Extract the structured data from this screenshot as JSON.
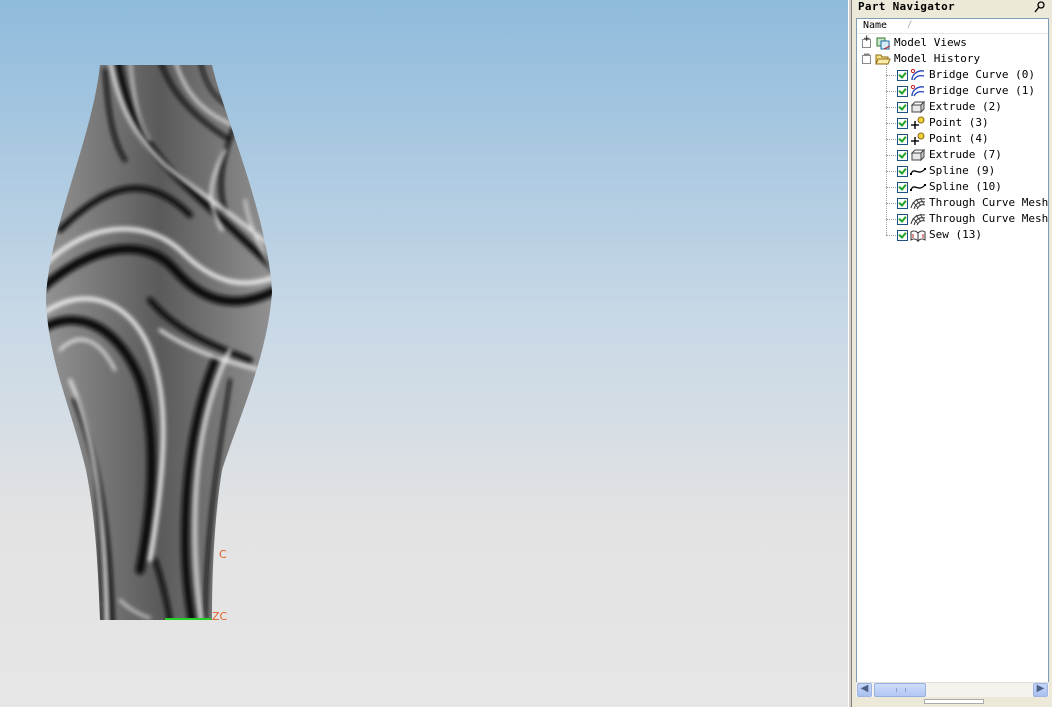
{
  "viewport": {
    "axis_labels": [
      "C",
      "ZC"
    ],
    "colors": {
      "axis_label": "#e0622a",
      "axis_green": "#28d028"
    }
  },
  "navigator": {
    "title": "Part Navigator",
    "column_name": "Name",
    "column_sort_glyph": "/",
    "tree": [
      {
        "label": "Model Views",
        "icon": "model-views-icon",
        "expander": "+",
        "level": 0
      },
      {
        "label": "Model History",
        "icon": "open-folder-icon",
        "expander": "−",
        "level": 0
      },
      {
        "label": "Bridge Curve (0)",
        "icon": "bridge-curve-icon",
        "checked": true,
        "level": 1
      },
      {
        "label": "Bridge Curve (1)",
        "icon": "bridge-curve-icon",
        "checked": true,
        "level": 1
      },
      {
        "label": "Extrude (2)",
        "icon": "extrude-icon",
        "checked": true,
        "level": 1
      },
      {
        "label": "Point (3)",
        "icon": "point-icon",
        "checked": true,
        "level": 1
      },
      {
        "label": "Point (4)",
        "icon": "point-icon",
        "checked": true,
        "level": 1
      },
      {
        "label": "Extrude (7)",
        "icon": "extrude-icon",
        "checked": true,
        "level": 1
      },
      {
        "label": "Spline (9)",
        "icon": "spline-icon",
        "checked": true,
        "level": 1
      },
      {
        "label": "Spline (10)",
        "icon": "spline-icon",
        "checked": true,
        "level": 1
      },
      {
        "label": "Through Curve Mesh (",
        "icon": "through-curve-mesh-icon",
        "checked": true,
        "level": 1
      },
      {
        "label": "Through Curve Mesh (",
        "icon": "through-curve-mesh-icon",
        "checked": true,
        "level": 1
      },
      {
        "label": "Sew (13)",
        "icon": "sew-icon",
        "checked": true,
        "level": 1
      }
    ]
  }
}
